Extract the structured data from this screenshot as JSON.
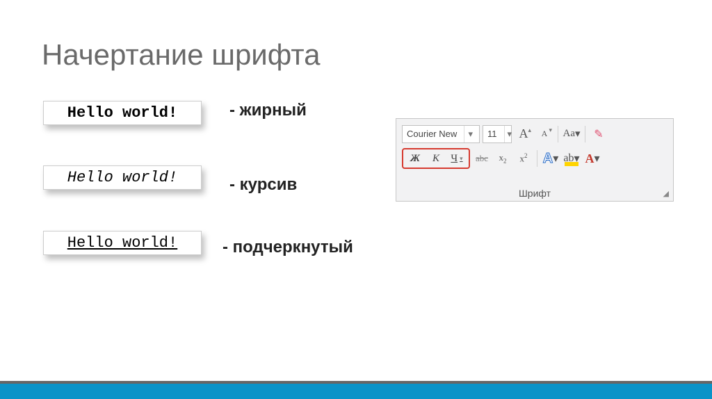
{
  "title": "Начертание шрифта",
  "examples": {
    "bold": {
      "text": "Hello world!",
      "label": "- жирный"
    },
    "italic": {
      "text": "Hello world!",
      "label": "- курсив"
    },
    "underline": {
      "text": "Hello world!",
      "label": "- подчеркнутый"
    }
  },
  "ribbon": {
    "caption": "Шрифт",
    "font_family": "Courier New",
    "font_size": "11",
    "grow_label": "A",
    "shrink_label": "A",
    "case_label": "Aa",
    "bold_btn": "Ж",
    "italic_btn": "К",
    "underline_btn": "Ч",
    "strike_label": "abc",
    "subscript_label": "x",
    "superscript_label": "x",
    "text_effects_label": "A",
    "highlight_label": "ab",
    "font_color_label": "A"
  }
}
